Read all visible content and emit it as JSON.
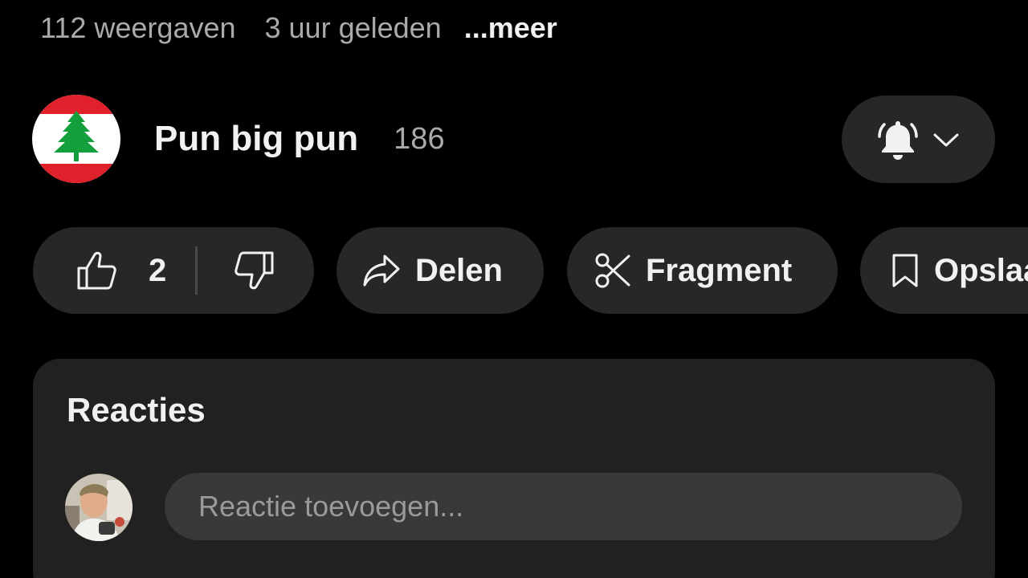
{
  "video_meta": {
    "views": "112 weergaven",
    "age": "3 uur geleden",
    "more": "...meer"
  },
  "channel": {
    "name": "Pun big pun",
    "subscribers": "186",
    "avatar_icon": "lebanon-flag-icon"
  },
  "subscription": {
    "bell_icon": "bell-icon",
    "dropdown_icon": "chevron-down-icon"
  },
  "actions": {
    "like_count": "2",
    "share_label": "Delen",
    "clip_label": "Fragment",
    "save_label": "Opslaan"
  },
  "comments": {
    "title": "Reacties",
    "placeholder": "Reactie toevoegen..."
  },
  "colors": {
    "background": "#000000",
    "pill": "#272727",
    "card": "#212121",
    "input": "#393939",
    "secondary_text": "#aaaaaa"
  }
}
